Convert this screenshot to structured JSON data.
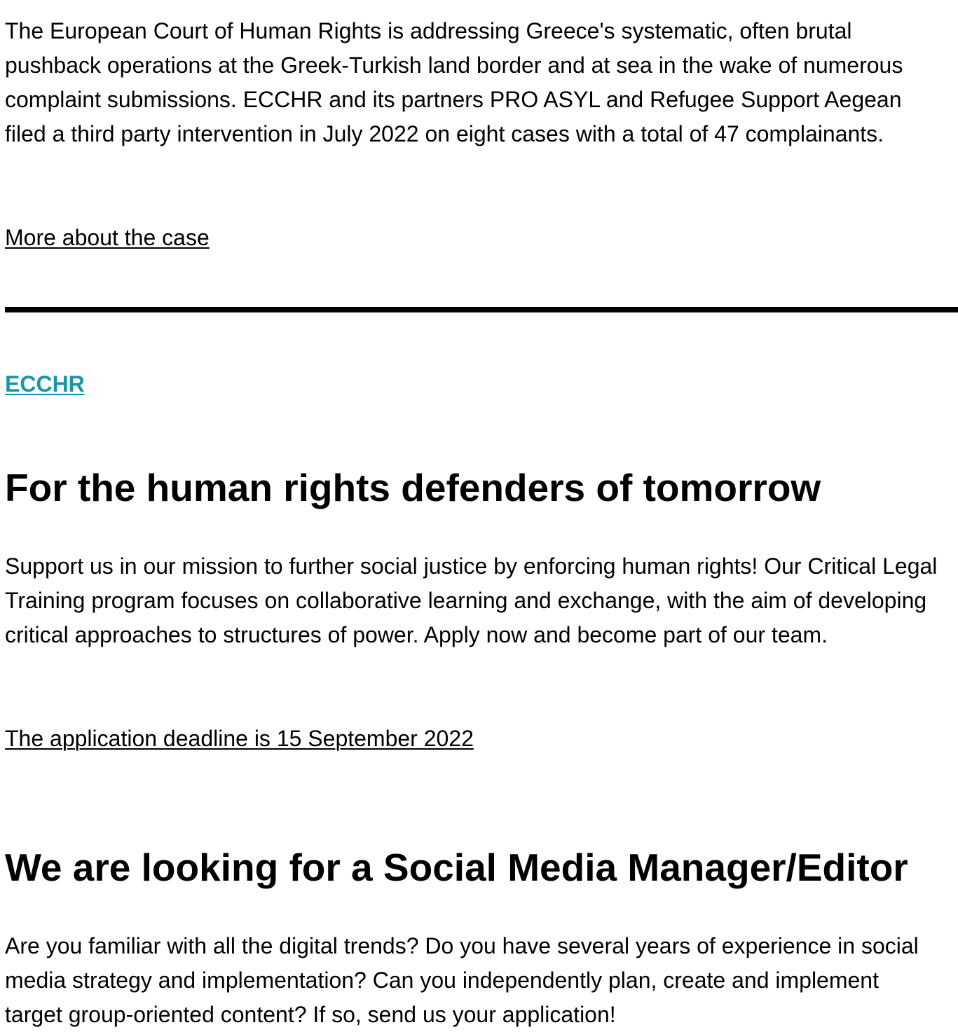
{
  "case_section": {
    "paragraph": "The European Court of Human Rights is addressing Greece's systematic, often brutal pushback operations at the Greek-Turkish land border and at sea in the wake of numerous complaint submissions. ECCHR and its partners PRO ASYL and Refugee Support Aegean filed a third party intervention in July 2022 on eight cases with a total of 47 complainants.",
    "link_label": "More about the case"
  },
  "brand": {
    "name": "ECCHR",
    "color": "#1797a6"
  },
  "training_section": {
    "heading": "For the human rights defenders of tomorrow",
    "paragraph": "Support us in our mission to further social justice by enforcing human rights! Our Critical Legal Training program focuses on collaborative learning and exchange, with the aim of developing critical approaches to structures of power. Apply now and become part of our team.",
    "link_label": "The application deadline is 15 September 2022"
  },
  "job_section": {
    "heading": "We are looking for a Social Media Manager/Editor",
    "paragraph": "Are you familiar with all the digital trends? Do you have several years of experience in social media strategy and implementation? Can you independently plan, create and implement target group-oriented content? If so, send us your application!"
  }
}
